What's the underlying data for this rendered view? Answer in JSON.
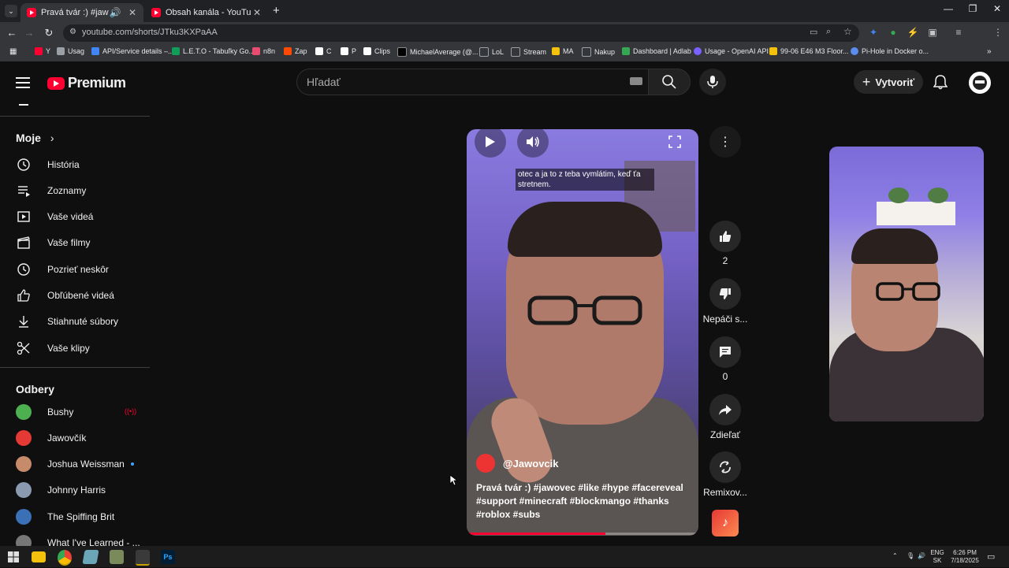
{
  "browser": {
    "tabs": [
      {
        "title": "Pravá tvár :) #jawovec #like",
        "active": true
      },
      {
        "title": "Obsah kanála - YouTube Studio",
        "active": false
      }
    ],
    "new_tab": "+",
    "url": "youtube.com/shorts/JTku3KXPaAA"
  },
  "bookmarks": [
    {
      "label": "Y",
      "color": "#ff0033"
    },
    {
      "label": "Usag",
      "color": "#9aa0a6"
    },
    {
      "label": "API/Service details –...",
      "color": "#4285f4"
    },
    {
      "label": "L.E.T.O - Tabuľky Go...",
      "color": "#0f9d58"
    },
    {
      "label": "n8n",
      "color": "#ea4b71"
    },
    {
      "label": "Zap",
      "color": "#ff4a00"
    },
    {
      "label": "C",
      "color": "#ffffff"
    },
    {
      "label": "P",
      "color": "#ffffff"
    },
    {
      "label": "Clips",
      "color": "#ffffff"
    },
    {
      "label": "MichaelAverage (@...",
      "color": "#000000"
    },
    {
      "label": "LoL",
      "color": "#9aa0a6"
    },
    {
      "label": "Stream",
      "color": "#9aa0a6"
    },
    {
      "label": "MA",
      "color": "#f4c20d"
    },
    {
      "label": "Nakup",
      "color": "#9aa0a6"
    },
    {
      "label": "Dashboard | Adlab",
      "color": "#34a853"
    },
    {
      "label": "Usage - OpenAI API",
      "color": "#7b61ff"
    },
    {
      "label": "99-06 E46 M3 Floor...",
      "color": "#f4c20d"
    },
    {
      "label": "Pi-Hole in Docker o...",
      "color": "#5b8def"
    }
  ],
  "header": {
    "brand": "Premium",
    "search_placeholder": "Hľadať",
    "create_label": "Vytvoriť"
  },
  "sidebar": {
    "you_heading": "Moje",
    "items": [
      {
        "label": "História",
        "icon": "history-icon"
      },
      {
        "label": "Zoznamy",
        "icon": "playlists-icon"
      },
      {
        "label": "Vaše videá",
        "icon": "your-videos-icon"
      },
      {
        "label": "Vaše filmy",
        "icon": "movies-icon"
      },
      {
        "label": "Pozrieť neskôr",
        "icon": "watch-later-icon"
      },
      {
        "label": "Obľúbené videá",
        "icon": "liked-icon"
      },
      {
        "label": "Stiahnuté súbory",
        "icon": "download-icon"
      },
      {
        "label": "Vaše klipy",
        "icon": "clips-icon"
      }
    ],
    "subs_heading": "Odbery",
    "subscriptions": [
      {
        "name": "Bushy",
        "color": "#4caf50",
        "live": true
      },
      {
        "name": "Jawovčík",
        "color": "#e53935",
        "live": false
      },
      {
        "name": "Joshua Weissman",
        "color": "#c58b6b",
        "dot": true
      },
      {
        "name": "Johnny Harris",
        "color": "#8a9bb0",
        "live": false
      },
      {
        "name": "The Spiffing Brit",
        "color": "#3b6fb6",
        "live": false
      },
      {
        "name": "What I've Learned - ...",
        "color": "#777777",
        "live": false
      }
    ]
  },
  "short": {
    "caption": "otec a ja to z teba vymlátim, keď ťa stretnem.",
    "channel": "@Jawovcik",
    "description": "Pravá tvár :) #jawovec #like #hype #facereveal #support #minecraft #blockmango #thanks #roblox #subs",
    "progress": 0.6
  },
  "actions": {
    "like_count": "2",
    "dislike_label": "Nepáči s...",
    "comment_count": "0",
    "share_label": "Zdieľať",
    "remix_label": "Remixov..."
  },
  "taskbar": {
    "lang_top": "ENG",
    "lang_bottom": "SK",
    "time": "6:26 PM",
    "date": "7/18/2025"
  },
  "colors": {
    "accent": "#ff0033",
    "background": "#0f0f0f"
  }
}
